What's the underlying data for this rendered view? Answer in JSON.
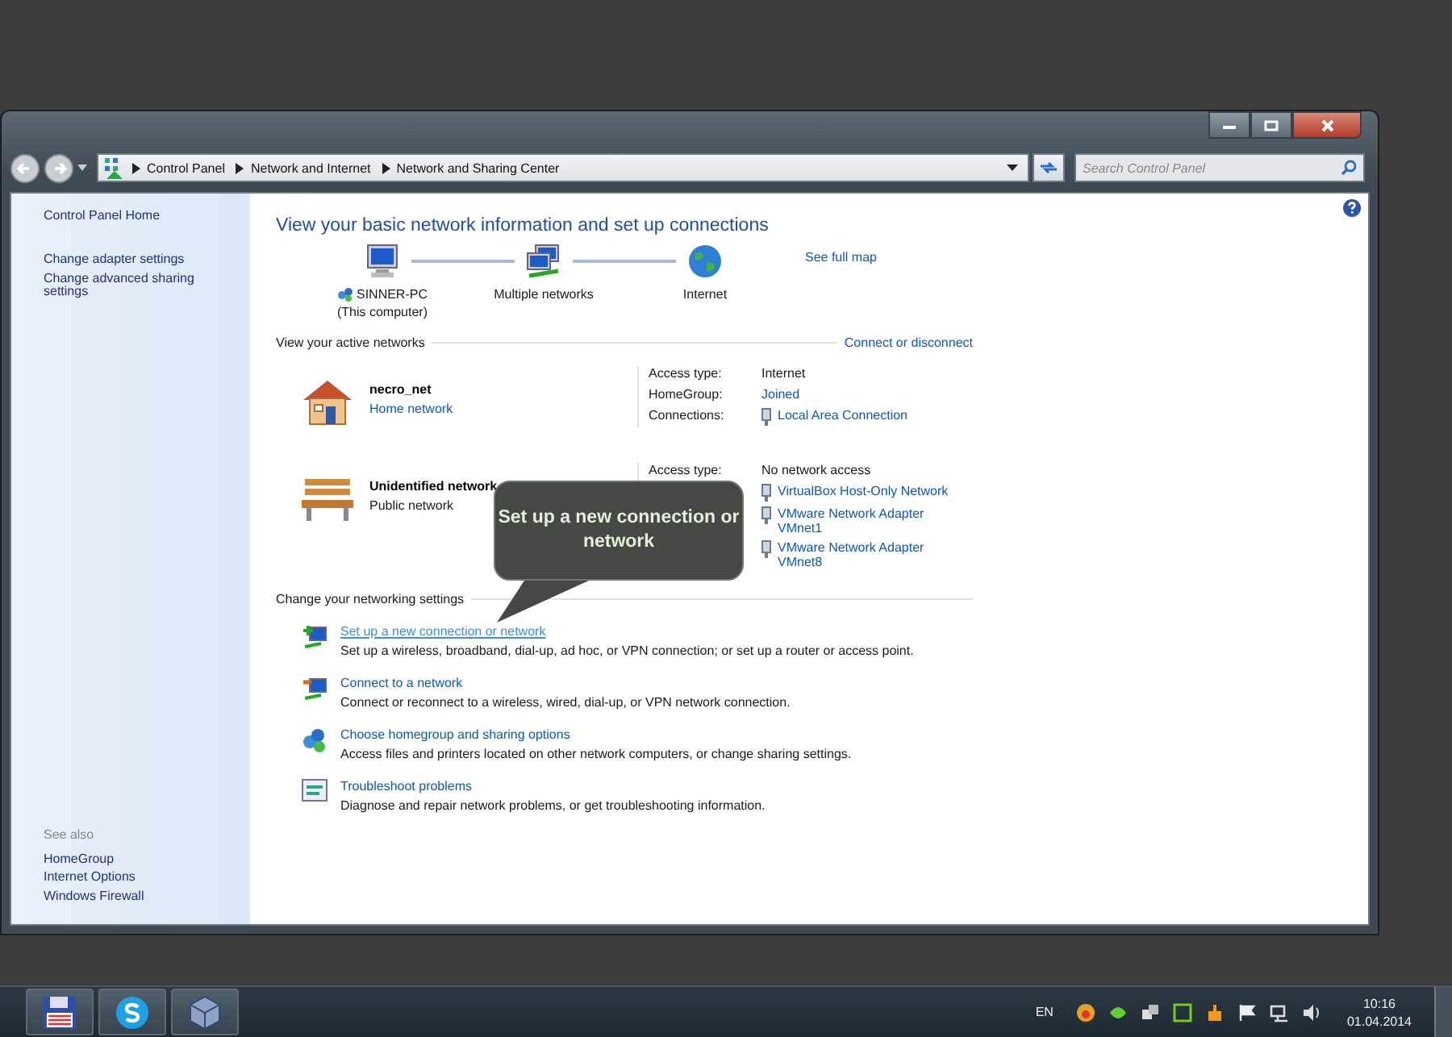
{
  "window": {
    "breadcrumb": [
      "Control Panel",
      "Network and Internet",
      "Network and Sharing Center"
    ],
    "search": {
      "placeholder": "Search Control Panel"
    }
  },
  "sidebar": {
    "items": [
      "Control Panel Home",
      "Change adapter settings",
      "Change advanced sharing settings"
    ],
    "see_also_heading": "See also",
    "see_also": [
      "HomeGroup",
      "Internet Options",
      "Windows Firewall"
    ]
  },
  "main": {
    "title": "View your basic network information and set up connections",
    "map": {
      "nodes": [
        {
          "kind": "computer",
          "label": "SINNER-PC",
          "sublabel": "(This computer)"
        },
        {
          "kind": "networks",
          "label": "Multiple networks"
        },
        {
          "kind": "internet",
          "label": "Internet"
        }
      ],
      "link": "See full map"
    },
    "active_networks": {
      "heading": "View your active networks",
      "link": "Connect or disconnect",
      "networks": [
        {
          "kind": "home",
          "name": "necro_net",
          "type": "Home network",
          "type_is_link": true,
          "details": [
            {
              "kind": "text",
              "label": "Access type:",
              "value": "Internet"
            },
            {
              "kind": "link",
              "label": "HomeGroup:",
              "value": "Joined"
            },
            {
              "kind": "connections",
              "label": "Connections:",
              "values": [
                "Local Area Connection"
              ]
            }
          ]
        },
        {
          "kind": "public",
          "name": "Unidentified network",
          "type": "Public network",
          "type_is_link": false,
          "details": [
            {
              "kind": "text",
              "label": "Access type:",
              "value": "No network access"
            },
            {
              "kind": "connections",
              "values": [
                "VirtualBox Host-Only Network",
                "VMware Network Adapter VMnet1",
                "VMware Network Adapter VMnet8"
              ]
            }
          ]
        }
      ]
    },
    "settings": {
      "heading": "Change your networking settings",
      "tasks": [
        {
          "kind": "new-connection",
          "title": "Set up a new connection or network",
          "hovered": true,
          "description": "Set up a wireless, broadband, dial-up, ad hoc, or VPN connection; or set up a router or access point."
        },
        {
          "kind": "connect",
          "title": "Connect to a network",
          "hovered": false,
          "description": "Connect or reconnect to a wireless, wired, dial-up, or VPN network connection."
        },
        {
          "kind": "homegroup",
          "title": "Choose homegroup and sharing options",
          "hovered": false,
          "description": "Access files and printers located on other network computers, or change sharing settings."
        },
        {
          "kind": "troubleshoot",
          "title": "Troubleshoot problems",
          "hovered": false,
          "description": "Diagnose and repair network problems, or get troubleshooting information."
        }
      ]
    }
  },
  "tooltip": "Set up a new connection or network",
  "taskbar": {
    "apps": [
      {
        "kind": "save"
      },
      {
        "kind": "skype"
      },
      {
        "kind": "virtualbox"
      }
    ],
    "language": "EN",
    "time": "10:16",
    "date": "01.04.2014"
  }
}
